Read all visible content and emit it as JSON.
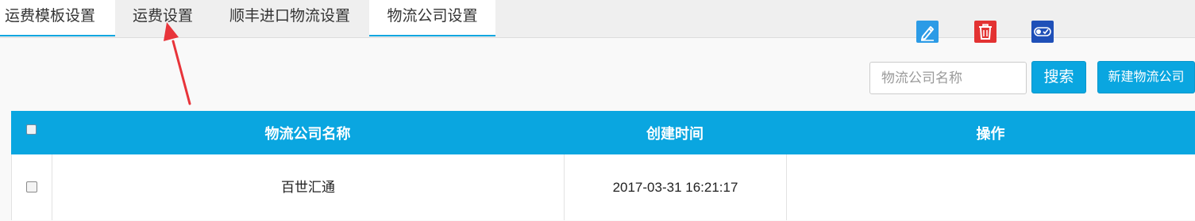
{
  "tabs": [
    {
      "label": "运费模板设置"
    },
    {
      "label": "运费设置"
    },
    {
      "label": "顺丰进口物流设置"
    },
    {
      "label": "物流公司设置"
    }
  ],
  "toolbar": {
    "search_placeholder": "物流公司名称",
    "search_value": "",
    "search_label": "搜索",
    "new_label": "新建物流公司"
  },
  "table": {
    "headers": [
      "物流公司名称",
      "创建时间",
      "操作"
    ],
    "rows": [
      {
        "name": "百世汇通",
        "created": "2017-03-31 16:21:17"
      }
    ]
  },
  "icons": {
    "edit": "edit-icon",
    "delete": "trash-icon",
    "toggle": "toggle-icon",
    "annotation": "red-arrow-annotation"
  },
  "colors": {
    "accent": "#0aa6e0",
    "edit": "#2c9be6",
    "delete": "#e33232",
    "toggle": "#1f50b8",
    "annotation": "#e8343a"
  }
}
